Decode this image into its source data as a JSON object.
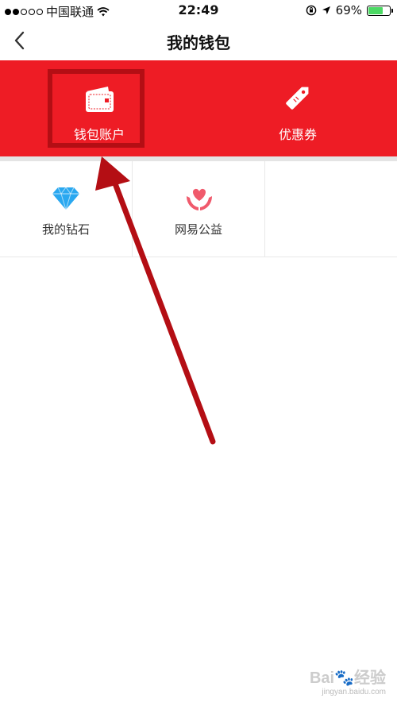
{
  "status_bar": {
    "carrier": "中国联通",
    "time": "22:49",
    "battery_percent": "69%",
    "battery_level": 0.69,
    "signal_bars": 2,
    "icons": [
      "wifi-icon",
      "orientation-lock-icon",
      "location-arrow-icon",
      "battery-icon"
    ]
  },
  "nav": {
    "title": "我的钱包",
    "back_icon": "chevron-left-icon"
  },
  "top_actions": [
    {
      "label": "钱包账户",
      "icon": "wallet-icon"
    },
    {
      "label": "优惠券",
      "icon": "coupon-tag-icon"
    }
  ],
  "grid_items": [
    {
      "label": "我的钻石",
      "icon": "diamond-icon"
    },
    {
      "label": "网易公益",
      "icon": "charity-heart-hands-icon"
    }
  ],
  "annotation": {
    "color": "#b40e14"
  },
  "watermark": {
    "logo": "Bai🐾经验",
    "sub": "jingyan.baidu.com"
  },
  "colors": {
    "brand_red": "#ee1c25",
    "diamond_blue": "#2aa8f0",
    "charity_pink": "#f05a6c"
  }
}
